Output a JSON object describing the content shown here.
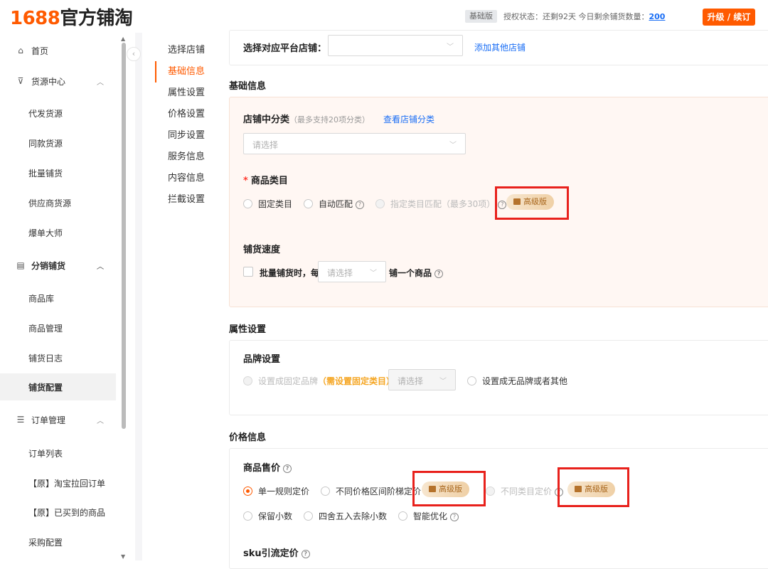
{
  "header": {
    "logo_num": "1688",
    "logo_text": "官方铺淘",
    "edition": "基础版",
    "auth_prefix": "授权状态：还剩92天 今日剩余铺货数量：",
    "auth_count": "200",
    "upgrade_label": "升级 / 续订"
  },
  "sidebar": {
    "home": "首页",
    "source_center": "货源中心",
    "source_items": [
      "代发货源",
      "同款货源",
      "批量铺货",
      "供应商货源",
      "爆单大师"
    ],
    "distribution": "分销铺货",
    "distribution_items": [
      "商品库",
      "商品管理",
      "铺货日志",
      "铺货配置"
    ],
    "orders": "订单管理",
    "order_items": [
      "订单列表",
      "【原】淘宝拉回订单",
      "【原】已买到的商品",
      "采购配置"
    ]
  },
  "anchor_menu": [
    "选择店铺",
    "基础信息",
    "属性设置",
    "价格设置",
    "同步设置",
    "服务信息",
    "内容信息",
    "拦截设置"
  ],
  "store": {
    "label": "选择对应平台店铺：",
    "add_link": "添加其他店铺"
  },
  "basic": {
    "title": "基础信息",
    "shop_category_label": "店铺中分类",
    "shop_category_hint": "（最多支持20项分类）",
    "view_link": "查看店铺分类",
    "select_placeholder": "请选择",
    "category_label": "商品类目",
    "category_options": [
      "固定类目",
      "自动匹配",
      "指定类目匹配（最多30项）"
    ],
    "advanced_badge": "高级版",
    "speed_label": "铺货速度",
    "speed_prefix": "批量铺货时，每",
    "speed_placeholder": "请选择",
    "speed_suffix": "铺一个商品"
  },
  "attr": {
    "title": "属性设置",
    "brand_label": "品牌设置",
    "brand_fixed": "设置成固定品牌",
    "brand_need": "（需设置固定类目）",
    "brand_placeholder": "请选择",
    "brand_none": "设置成无品牌或者其他"
  },
  "price": {
    "title": "价格信息",
    "sale_label": "商品售价",
    "rule_options": [
      "单一规则定价",
      "不同价格区间阶梯定价",
      "不同类目定价"
    ],
    "advanced_badge": "高级版",
    "round_options": [
      "保留小数",
      "四舍五入去除小数",
      "智能优化"
    ],
    "sku_label": "sku引流定价"
  }
}
